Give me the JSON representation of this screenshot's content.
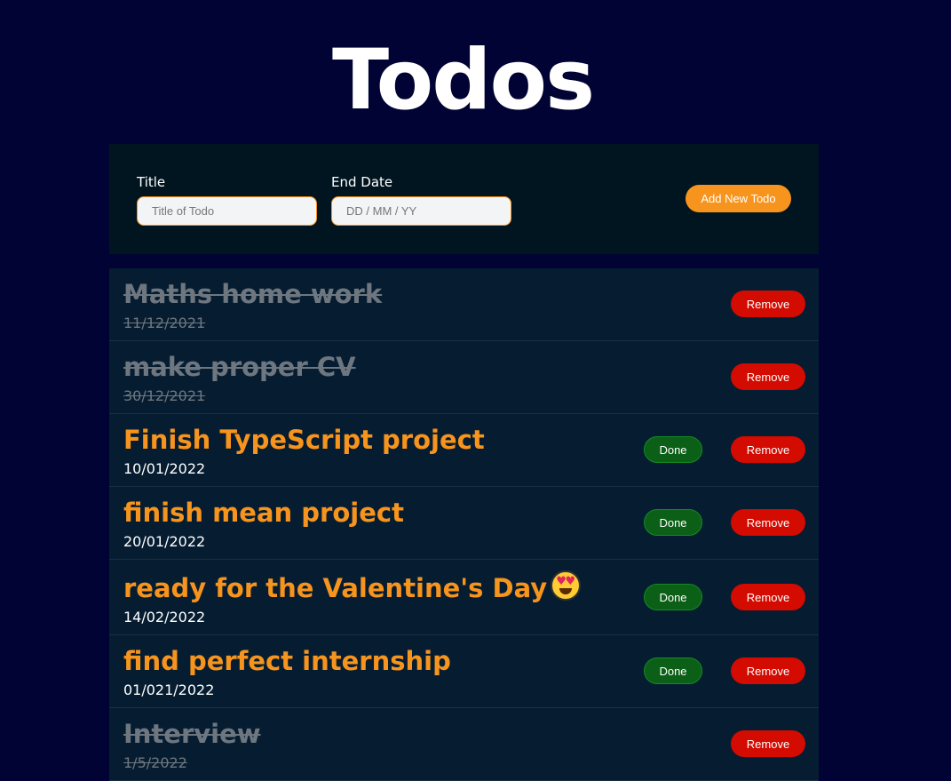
{
  "header": {
    "title": "Todos"
  },
  "form": {
    "title_label": "Title",
    "title_placeholder": "Title of Todo",
    "title_value": "",
    "date_label": "End Date",
    "date_placeholder": "DD / MM / YY",
    "date_value": "",
    "add_button_label": "Add New Todo"
  },
  "colors": {
    "background": "#000333",
    "accent": "#f7941d",
    "done_button": "#0b5f17",
    "remove_button": "#d30b00",
    "completed_text": "#6e7780"
  },
  "todos": [
    {
      "title": "Maths home work",
      "date": "11/12/2021",
      "completed": true,
      "remove_label": "Remove"
    },
    {
      "title": "make proper CV",
      "date": "30/12/2021",
      "completed": true,
      "remove_label": "Remove"
    },
    {
      "title": "Finish TypeScript project",
      "date": "10/01/2022",
      "completed": false,
      "done_label": "Done",
      "remove_label": "Remove"
    },
    {
      "title": "finish mean project",
      "date": "20/01/2022",
      "completed": false,
      "done_label": "Done",
      "remove_label": "Remove"
    },
    {
      "title": "ready for the Valentine's Day",
      "date": "14/02/2022",
      "completed": false,
      "emoji": "heart-eyes-emoji-icon",
      "done_label": "Done",
      "remove_label": "Remove"
    },
    {
      "title": "find perfect internship",
      "date": "01/021/2022",
      "completed": false,
      "done_label": "Done",
      "remove_label": "Remove"
    },
    {
      "title": "Interview",
      "date": "1/5/2022",
      "completed": true,
      "remove_label": "Remove"
    }
  ]
}
